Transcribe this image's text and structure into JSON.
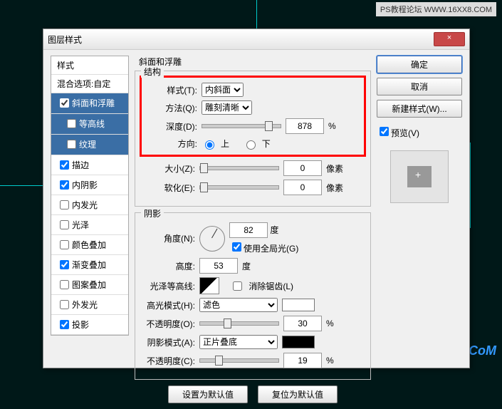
{
  "watermark": "PS教程论坛 WWW.16XX8.COM",
  "watermark2": "UiBQ.CoM",
  "dialog": {
    "title": "图层样式",
    "close": "×"
  },
  "left": {
    "header": "样式",
    "blend": "混合选项:自定",
    "items": [
      {
        "label": "斜面和浮雕",
        "checked": true,
        "selected": true
      },
      {
        "label": "等高线",
        "checked": false,
        "indent": true,
        "selected": true
      },
      {
        "label": "纹理",
        "checked": false,
        "indent": true,
        "selected": true
      },
      {
        "label": "描边",
        "checked": true
      },
      {
        "label": "内阴影",
        "checked": true
      },
      {
        "label": "内发光",
        "checked": false
      },
      {
        "label": "光泽",
        "checked": false
      },
      {
        "label": "颜色叠加",
        "checked": false
      },
      {
        "label": "渐变叠加",
        "checked": true
      },
      {
        "label": "图案叠加",
        "checked": false
      },
      {
        "label": "外发光",
        "checked": false
      },
      {
        "label": "投影",
        "checked": true
      }
    ]
  },
  "bevel": {
    "section": "斜面和浮雕",
    "group1": "结构",
    "style_lbl": "样式(T):",
    "style_val": "内斜面",
    "tech_lbl": "方法(Q):",
    "tech_val": "雕刻清晰",
    "depth_lbl": "深度(D):",
    "depth_val": "878",
    "pct": "%",
    "dir_lbl": "方向:",
    "dir_up": "上",
    "dir_down": "下",
    "size_lbl": "大小(Z):",
    "size_val": "0",
    "px": "像素",
    "soften_lbl": "软化(E):",
    "soften_val": "0",
    "group2": "阴影",
    "angle_lbl": "角度(N):",
    "angle_val": "82",
    "deg": "度",
    "global": "使用全局光(G)",
    "alt_lbl": "高度:",
    "alt_val": "53",
    "gloss_lbl": "光泽等高线:",
    "anti": "消除锯齿(L)",
    "hmode_lbl": "高光模式(H):",
    "hmode_val": "滤色",
    "hop_lbl": "不透明度(O):",
    "hop_val": "30",
    "smode_lbl": "阴影模式(A):",
    "smode_val": "正片叠底",
    "sop_lbl": "不透明度(C):",
    "sop_val": "19",
    "reset": "设置为默认值",
    "restore": "复位为默认值"
  },
  "right": {
    "ok": "确定",
    "cancel": "取消",
    "newstyle": "新建样式(W)...",
    "preview": "预览(V)"
  }
}
